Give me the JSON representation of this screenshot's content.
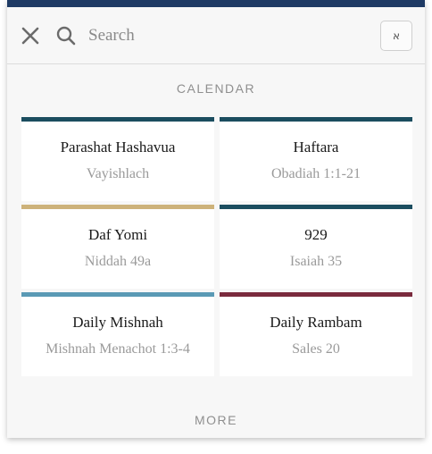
{
  "search": {
    "placeholder": "Search",
    "keyboard_label": "א"
  },
  "icons": {
    "close": "close-icon",
    "search": "search-icon",
    "keyboard": "hebrew-keyboard-icon"
  },
  "colors": {
    "top_band": "#1e3a64",
    "parasha": "#1b4d5f",
    "haftara": "#1b4d5f",
    "daf_yomi": "#cdb27a",
    "nine_two_nine": "#1b4d5f",
    "daily_mishnah": "#5a9ab5",
    "daily_rambam": "#7a2a3d"
  },
  "calendar": {
    "heading": "CALENDAR",
    "items": [
      {
        "title": "Parashat Hashavua",
        "subtitle": "Vayishlach",
        "color": "#1b4d5f"
      },
      {
        "title": "Haftara",
        "subtitle": "Obadiah 1:1-21",
        "color": "#1b4d5f"
      },
      {
        "title": "Daf Yomi",
        "subtitle": "Niddah 49a",
        "color": "#cdb27a"
      },
      {
        "title": "929",
        "subtitle": "Isaiah 35",
        "color": "#1b4d5f"
      },
      {
        "title": "Daily Mishnah",
        "subtitle": "Mishnah Menachot 1:3-4",
        "color": "#5a9ab5"
      },
      {
        "title": "Daily Rambam",
        "subtitle": "Sales 20",
        "color": "#7a2a3d"
      }
    ],
    "more_label": "MORE"
  }
}
